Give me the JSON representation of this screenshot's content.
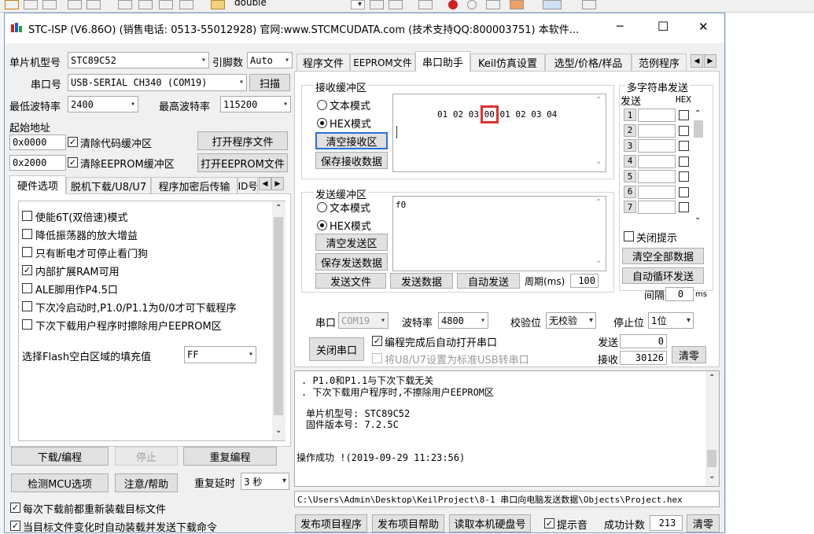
{
  "toolbar": {
    "doc_name": "double"
  },
  "window": {
    "title": "STC-ISP (V6.86O) (销售电话: 0513-55012928) 官网:www.STCMCUDATA.com  (技术支持QQ:800003751) 本软件...",
    "minimize": "─",
    "maximize": "☐",
    "close": "✕"
  },
  "left": {
    "mcu_label": "单片机型号",
    "mcu_value": "STC89C52",
    "pins_label": "引脚数",
    "pins_value": "Auto",
    "port_label": "串口号",
    "port_value": "USB-SERIAL CH340 (COM19)",
    "scan": "扫描",
    "min_baud_label": "最低波特率",
    "min_baud": "2400",
    "max_baud_label": "最高波特率",
    "max_baud": "115200",
    "start_addr_label": "起始地址",
    "addr1": "0x0000",
    "clear_code": "清除代码缓冲区",
    "open_prog": "打开程序文件",
    "addr2": "0x2000",
    "clear_eeprom": "清除EEPROM缓冲区",
    "open_eeprom": "打开EEPROM文件",
    "tabs": [
      "硬件选项",
      "脱机下载/U8/U7",
      "程序加密后传输",
      "ID号"
    ],
    "options": [
      {
        "label": "使能6T(双倍速)模式",
        "checked": false
      },
      {
        "label": "降低振荡器的放大增益",
        "checked": false
      },
      {
        "label": "只有断电才可停止看门狗",
        "checked": false
      },
      {
        "label": "内部扩展RAM可用",
        "checked": true
      },
      {
        "label": "ALE脚用作P4.5口",
        "checked": false
      },
      {
        "label": "下次冷启动时,P1.0/P1.1为0/0才可下载程序",
        "checked": false
      },
      {
        "label": "下次下载用户程序时擦除用户EEPROM区",
        "checked": false
      }
    ],
    "fill_label": "选择Flash空白区域的填充值",
    "fill_value": "FF",
    "download": "下载/编程",
    "stop": "停止",
    "reprogram": "重复编程",
    "detect": "检测MCU选项",
    "help": "注意/帮助",
    "delay_label": "重复延时",
    "delay_value": "3 秒",
    "reload": "每次下载前都重新装载目标文件",
    "autoload": "当目标文件变化时自动装载并发送下载命令"
  },
  "right": {
    "tabs": [
      "程序文件",
      "EEPROM文件",
      "串口助手",
      "Keil仿真设置",
      "选型/价格/样品",
      "范例程序"
    ],
    "recv": {
      "legend": "接收缓冲区",
      "text_mode": "文本模式",
      "hex_mode": "HEX模式",
      "clear": "清空接收区",
      "save": "保存接收数据",
      "content_a": "01 02 03 ",
      "content_hl": "00",
      "content_b": " 01 02 03 04"
    },
    "send": {
      "legend": "发送缓冲区",
      "text_mode": "文本模式",
      "hex_mode": "HEX模式",
      "clear": "清空发送区",
      "save": "保存发送数据",
      "content": "f0",
      "send_file": "发送文件",
      "send_data": "发送数据",
      "auto_send": "自动发送",
      "period_label": "周期(ms)",
      "period": "100"
    },
    "multi": {
      "legend": "多字符串发送",
      "col_send": "发送",
      "col_hex": "HEX",
      "rows": [
        "1",
        "2",
        "3",
        "4",
        "5",
        "6",
        "7"
      ],
      "close_tip": "关闭提示",
      "clear_all": "清空全部数据",
      "auto_loop": "自动循环发送",
      "interval_label": "间隔",
      "interval": "0",
      "interval_unit": "ms"
    },
    "port": {
      "label": "串口",
      "value": "COM19",
      "baud_label": "波特率",
      "baud": "4800",
      "parity_label": "校验位",
      "parity": "无校验",
      "stop_label": "停止位",
      "stop": "1位",
      "close": "关闭串口",
      "auto_open": "编程完成后自动打开串口",
      "usb": "将U8/U7设置为标准USB转串口",
      "sent_label": "发送",
      "sent": "0",
      "recv_label": "接收",
      "recvd": "30126",
      "clear_count": "清零"
    },
    "log": {
      "line1": ".  P1.0和P1.1与下次下载无关",
      "line2": ".  下次下载用户程序时,不擦除用户EEPROM区",
      "line3": "单片机型号: STC89C52",
      "line4": "固件版本号: 7.2.5C",
      "line5": "操作成功 !(2019-09-29 11:23:56)"
    },
    "path": "C:\\Users\\Admin\\Desktop\\KeilProject\\8-1 串口向电脑发送数据\\Objects\\Project.hex",
    "bottom": {
      "publish": "发布项目程序",
      "publish_help": "发布项目帮助",
      "read_disk": "读取本机硬盘号",
      "beep": "提示音",
      "success_label": "成功计数",
      "success": "213",
      "clear": "清零"
    }
  }
}
